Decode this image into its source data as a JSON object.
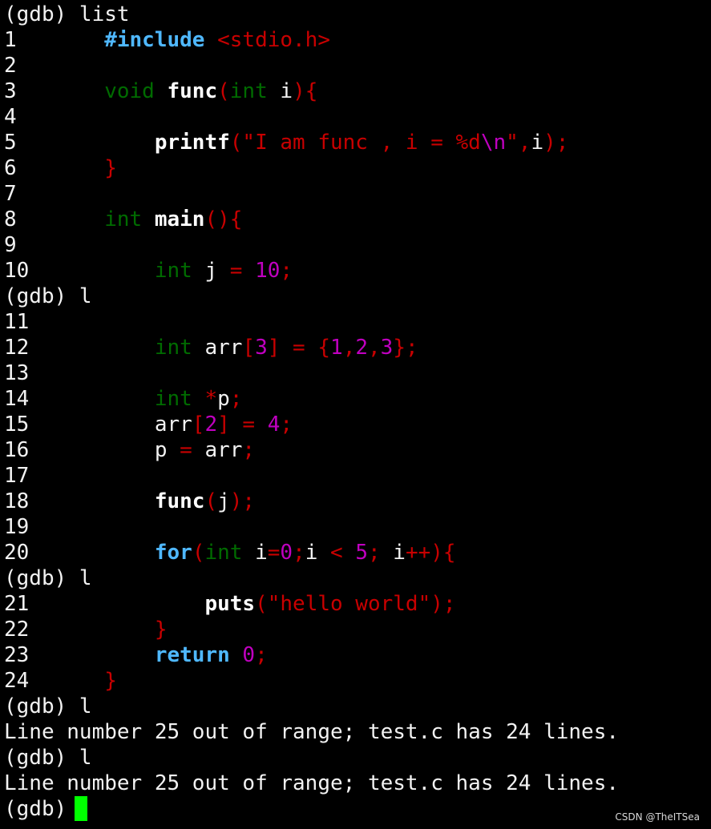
{
  "colors": {
    "background": "#000000",
    "text": "#f2f2f2",
    "keyword_blue": "#4fb8ff",
    "red": "#c80000",
    "green": "#006b00",
    "magenta": "#c000c0",
    "cursor": "#00ff00"
  },
  "lines": [
    {
      "text": "(gdb) list"
    },
    {
      "num": "1",
      "code": [
        [
          "#include",
          "b"
        ],
        [
          " ",
          "w"
        ],
        [
          "<stdio.h>",
          "r"
        ]
      ]
    },
    {
      "num": "2",
      "code": []
    },
    {
      "num": "3",
      "code": [
        [
          "void",
          "g"
        ],
        [
          " ",
          "w"
        ],
        [
          "func",
          "wb"
        ],
        [
          "(",
          "r"
        ],
        [
          "int",
          "g"
        ],
        [
          " i",
          "w"
        ],
        [
          "){",
          "r"
        ]
      ]
    },
    {
      "num": "4",
      "code": []
    },
    {
      "num": "5",
      "code": [
        [
          "    ",
          "w"
        ],
        [
          "printf",
          "wb"
        ],
        [
          "(\"I am func , i = %d",
          "r"
        ],
        [
          "\\n",
          "m"
        ],
        [
          "\",",
          "r"
        ],
        [
          "i",
          "w"
        ],
        [
          ");",
          "r"
        ]
      ]
    },
    {
      "num": "6",
      "code": [
        [
          "}",
          "r"
        ]
      ]
    },
    {
      "num": "7",
      "code": []
    },
    {
      "num": "8",
      "code": [
        [
          "int",
          "g"
        ],
        [
          " ",
          "w"
        ],
        [
          "main",
          "wb"
        ],
        [
          "(){",
          "r"
        ]
      ]
    },
    {
      "num": "9",
      "code": []
    },
    {
      "num": "10",
      "code": [
        [
          "    ",
          "w"
        ],
        [
          "int",
          "g"
        ],
        [
          " j ",
          "w"
        ],
        [
          "=",
          "r"
        ],
        [
          " ",
          "w"
        ],
        [
          "10",
          "m"
        ],
        [
          ";",
          "r"
        ]
      ]
    },
    {
      "text": "(gdb) l"
    },
    {
      "num": "11",
      "code": []
    },
    {
      "num": "12",
      "code": [
        [
          "    ",
          "w"
        ],
        [
          "int",
          "g"
        ],
        [
          " arr",
          "w"
        ],
        [
          "[",
          "r"
        ],
        [
          "3",
          "m"
        ],
        [
          "] = {",
          "r"
        ],
        [
          "1",
          "m"
        ],
        [
          ",",
          "r"
        ],
        [
          "2",
          "m"
        ],
        [
          ",",
          "r"
        ],
        [
          "3",
          "m"
        ],
        [
          "};",
          "r"
        ]
      ]
    },
    {
      "num": "13",
      "code": []
    },
    {
      "num": "14",
      "code": [
        [
          "    ",
          "w"
        ],
        [
          "int",
          "g"
        ],
        [
          " ",
          "w"
        ],
        [
          "*",
          "r"
        ],
        [
          "p",
          "w"
        ],
        [
          ";",
          "r"
        ]
      ]
    },
    {
      "num": "15",
      "code": [
        [
          "    arr",
          "w"
        ],
        [
          "[",
          "r"
        ],
        [
          "2",
          "m"
        ],
        [
          "] = ",
          "r"
        ],
        [
          "4",
          "m"
        ],
        [
          ";",
          "r"
        ]
      ]
    },
    {
      "num": "16",
      "code": [
        [
          "    p ",
          "w"
        ],
        [
          "=",
          "r"
        ],
        [
          " arr",
          "w"
        ],
        [
          ";",
          "r"
        ]
      ]
    },
    {
      "num": "17",
      "code": []
    },
    {
      "num": "18",
      "code": [
        [
          "    ",
          "w"
        ],
        [
          "func",
          "wb"
        ],
        [
          "(",
          "r"
        ],
        [
          "j",
          "w"
        ],
        [
          ");",
          "r"
        ]
      ]
    },
    {
      "num": "19",
      "code": []
    },
    {
      "num": "20",
      "code": [
        [
          "    ",
          "w"
        ],
        [
          "for",
          "b"
        ],
        [
          "(",
          "r"
        ],
        [
          "int",
          "g"
        ],
        [
          " i",
          "w"
        ],
        [
          "=",
          "r"
        ],
        [
          "0",
          "m"
        ],
        [
          ";",
          "r"
        ],
        [
          "i ",
          "w"
        ],
        [
          "<",
          "r"
        ],
        [
          " ",
          "w"
        ],
        [
          "5",
          "m"
        ],
        [
          ";",
          "r"
        ],
        [
          " i",
          "w"
        ],
        [
          "++){",
          "r"
        ]
      ]
    },
    {
      "text": "(gdb) l"
    },
    {
      "num": "21",
      "code": [
        [
          "        ",
          "w"
        ],
        [
          "puts",
          "wb"
        ],
        [
          "(\"hello world\");",
          "r"
        ]
      ]
    },
    {
      "num": "22",
      "code": [
        [
          "    ",
          "w"
        ],
        [
          "}",
          "r"
        ]
      ]
    },
    {
      "num": "23",
      "code": [
        [
          "    ",
          "w"
        ],
        [
          "return",
          "b"
        ],
        [
          " ",
          "w"
        ],
        [
          "0",
          "m"
        ],
        [
          ";",
          "r"
        ]
      ]
    },
    {
      "num": "24",
      "code": [
        [
          "}",
          "r"
        ]
      ]
    },
    {
      "text": "(gdb) l"
    },
    {
      "text": "Line number 25 out of range; test.c has 24 lines."
    },
    {
      "text": "(gdb) l"
    },
    {
      "text": "Line number 25 out of range; test.c has 24 lines."
    }
  ],
  "prompt": "(gdb)",
  "watermark": "CSDN @TheITSea"
}
